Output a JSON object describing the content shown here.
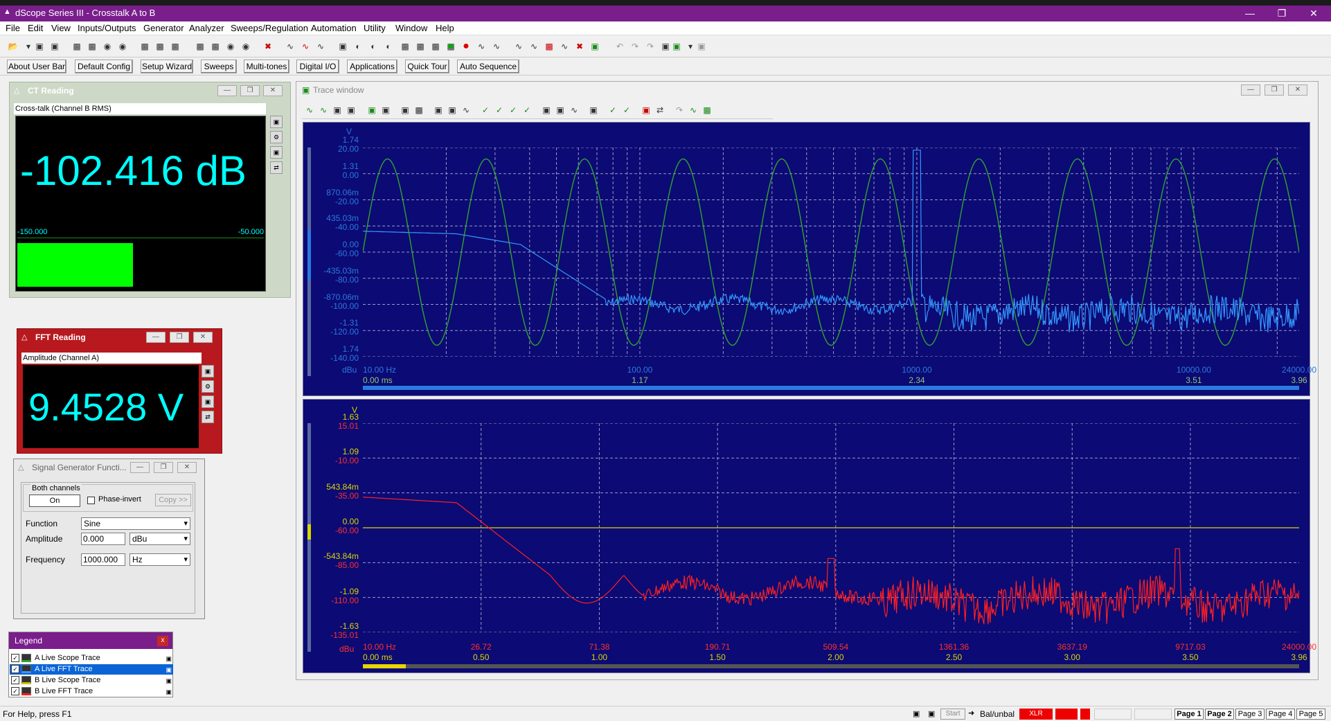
{
  "window": {
    "title": "dScope Series III - Crosstalk A to B",
    "min": "—",
    "max": "❐",
    "close": "✕"
  },
  "menu": [
    "File",
    "Edit",
    "View",
    "Inputs/Outputs",
    "Generator",
    "Analyzer",
    "Sweeps/Regulation",
    "Automation",
    "Utility",
    "Window",
    "Help"
  ],
  "userbar": [
    "About User Bar",
    "Default Config",
    "Setup Wizard",
    "Sweeps",
    "Multi-tones",
    "Digital I/O",
    "Applications",
    "Quick Tour",
    "Auto Sequence"
  ],
  "ct_reading": {
    "title": "CT Reading",
    "subtitle": "Cross-talk (Channel B RMS)",
    "value": "-102.416 dB",
    "scale_min": "-150.000",
    "scale_max": "-50.000",
    "bar_fraction": 0.47,
    "color": "#00ffff"
  },
  "fft_reading": {
    "title": "FFT Reading",
    "subtitle": "Amplitude (Channel A)",
    "value": "9.4528 V"
  },
  "siggen": {
    "title": "Signal Generator Functi...",
    "group": "Both channels",
    "on": "On",
    "phase": "Phase-invert",
    "copy": "Copy >>",
    "function_label": "Function",
    "function_value": "Sine",
    "amplitude_label": "Amplitude",
    "amplitude_value": "0.000",
    "amplitude_unit": "dBu",
    "frequency_label": "Frequency",
    "frequency_value": "1000.000",
    "frequency_unit": "Hz"
  },
  "legend": {
    "title": "Legend",
    "close": "x",
    "items": [
      {
        "label": "A  Live Scope Trace",
        "color": "#2fa52f"
      },
      {
        "label": "A  Live FFT Trace",
        "color": "#3399ff"
      },
      {
        "label": "B  Live Scope Trace",
        "color": "#c8c800"
      },
      {
        "label": "B  Live FFT Trace",
        "color": "#ff2020"
      }
    ]
  },
  "trace": {
    "title": "Trace window",
    "top": {
      "unit_top": "V",
      "unit_bottom": "dBu",
      "v_labels": [
        "1.74",
        "1.31",
        "870.06m",
        "435.03m",
        "0.00",
        "-435.03m",
        "-870.06m",
        "-1.31",
        "1.74"
      ],
      "db_labels": [
        "20.00",
        "0.00",
        "-20.00",
        "-40.00",
        "-60.00",
        "-80.00",
        "-100.00",
        "-120.00",
        "-140.00"
      ],
      "x_freq": [
        "10.00 Hz",
        "100.00",
        "1000.00",
        "10000.00",
        "24000.00"
      ],
      "x_time": [
        "0.00 ms",
        "1.17",
        "2.34",
        "3.51",
        "3.96"
      ]
    },
    "bottom": {
      "unit_top": "V",
      "unit_bottom": "dBu",
      "v_labels": [
        "1.63",
        "1.09",
        "543.84m",
        "0.00",
        "-543.84m",
        "-1.09",
        "-1.63"
      ],
      "db_labels": [
        "15.01",
        "-10.00",
        "-35.00",
        "-60.00",
        "-85.00",
        "-110.00",
        "-135.01"
      ],
      "x_freq": [
        "10.00 Hz",
        "26.72",
        "71.38",
        "190.71",
        "509.54",
        "1361.36",
        "3637.19",
        "9717.03",
        "24000.00"
      ],
      "x_time": [
        "0.00 ms",
        "0.50",
        "1.00",
        "1.50",
        "2.00",
        "2.50",
        "3.00",
        "3.50",
        "3.96"
      ]
    }
  },
  "status": {
    "help": "For Help, press F1",
    "start": "Start",
    "balunbal": "Bal/unbal",
    "xlr": "XLR",
    "pages": [
      "Page 1",
      "Page 2",
      "Page 3",
      "Page 4",
      "Page 5"
    ]
  }
}
